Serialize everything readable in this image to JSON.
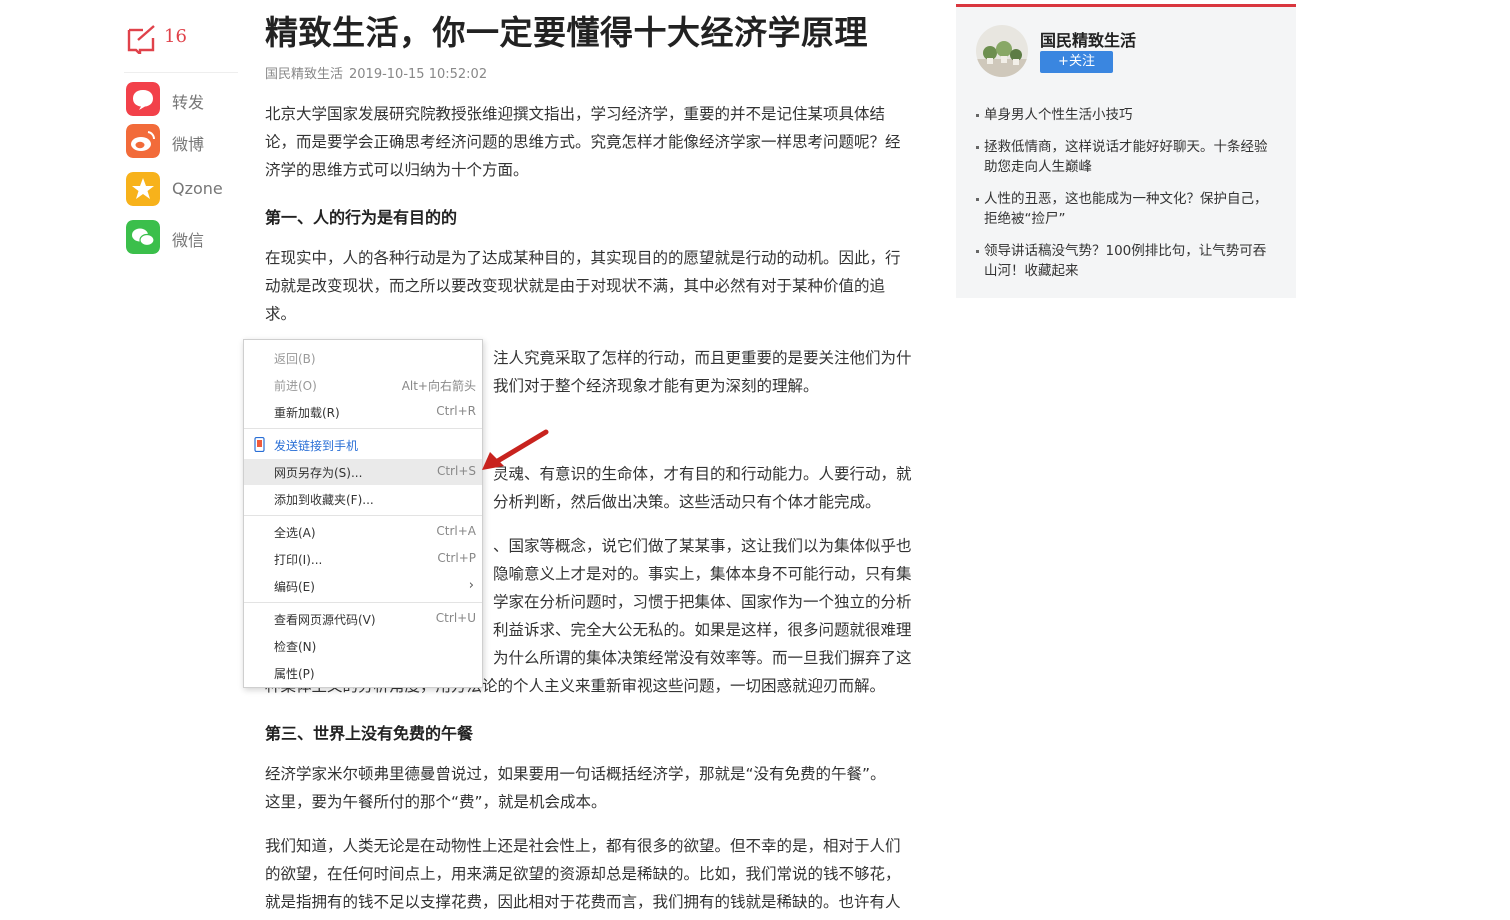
{
  "share": {
    "comment_count": "16",
    "items": [
      {
        "label": "转发",
        "icon": "repost-icon",
        "color": "#f2414a"
      },
      {
        "label": "微博",
        "icon": "weibo-icon",
        "color": "#f26b3a"
      },
      {
        "label": "Qzone",
        "icon": "qzone-icon",
        "color": "#f7b21b"
      },
      {
        "label": "微信",
        "icon": "wechat-icon",
        "color": "#3bbf4b"
      }
    ]
  },
  "article": {
    "title": "精致生活，你一定要懂得十大经济学原理",
    "author": "国民精致生活",
    "datetime": "2019-10-15 10:52:02",
    "p1_lines": [
      "北京大学国家发展研究院教授张维迎撰文指出，学习经济学，重要的并不是记住某项具体结",
      "论，而是要学会正确思考经济问题的思维方式。究竟怎样才能像经济学家一样思考问题呢？经",
      "济学的思维方式可以归纳为十个方面。"
    ],
    "h1": "第一、人的行为是有目的的",
    "p2_lines": [
      "在现实中，人的各种行动是为了达成某种目的，其实现目的的愿望就是行动的动机。因此，行",
      "动就是改变现状，而之所以要改变现状就是由于对现状不满，其中必然有对于某种价值的追",
      "求。"
    ],
    "p3_lines": [
      "注人究竟采取了怎样的行动，而且更重要的是要关注他们为什",
      "我们对于整个经济现象才能有更为深刻的理解。"
    ],
    "p4_lines": [
      "灵魂、有意识的生命体，才有目的和行动能力。人要行动，就",
      "分析判断，然后做出决策。这些活动只有个体才能完成。"
    ],
    "p5_lines": [
      "、国家等概念，说它们做了某某事，这让我们以为集体似乎也",
      "隐喻意义上才是对的。事实上，集体本身不可能行动，只有集",
      "学家在分析问题时，习惯于把集体、国家作为一个独立的分析",
      "利益诉求、完全大公无私的。如果是这样，很多问题就很难理",
      "为什么所谓的集体决策经常没有效率等。而一旦我们摒弃了这",
      "种集体主义的分析角度，用方法论的个人主义来重新审视这些问题，一切困惑就迎刃而解。"
    ],
    "h3": "第三、世界上没有免费的午餐",
    "p6_lines": [
      "经济学家米尔顿弗里德曼曾说过，如果要用一句话概括经济学，那就是“没有免费的午餐”。",
      "这里，要为午餐所付的那个“费”，就是机会成本。"
    ],
    "p7_lines": [
      "我们知道，人类无论是在动物性上还是社会性上，都有很多的欲望。但不幸的是，相对于人们",
      "的欲望，在任何时间点上，用来满足欲望的资源却总是稀缺的。比如，我们常说的钱不够花，",
      "就是指拥有的钱不足以支撑花费，因此相对于花费而言，我们拥有的钱就是稀缺的。也许有人"
    ]
  },
  "context_menu": {
    "back": {
      "label": "返回(B)",
      "shortcut": ""
    },
    "forward": {
      "label": "前进(O)",
      "shortcut": "Alt+向右箭头"
    },
    "reload": {
      "label": "重新加载(R)",
      "shortcut": "Ctrl+R"
    },
    "send": {
      "label": "发送链接到手机"
    },
    "save": {
      "label": "网页另存为(S)...",
      "shortcut": "Ctrl+S"
    },
    "bookmark": {
      "label": "添加到收藏夹(F)..."
    },
    "selectall": {
      "label": "全选(A)",
      "shortcut": "Ctrl+A"
    },
    "print": {
      "label": "打印(I)...",
      "shortcut": "Ctrl+P"
    },
    "encoding": {
      "label": "编码(E)"
    },
    "viewsource": {
      "label": "查看网页源代码(V)",
      "shortcut": "Ctrl+U"
    },
    "inspect": {
      "label": "检查(N)"
    },
    "properties": {
      "label": "属性(P)"
    }
  },
  "sidebar": {
    "author": "国民精致生活",
    "follow_label": "+关注",
    "related": [
      "单身男人个性生活小技巧",
      "拯救低情商，这样说话才能好好聊天。十条经验助您走向人生巅峰",
      "人性的丑恶，这也能成为一种文化？保护自己，拒绝被“捡尸”",
      "领导讲话稿没气势？100例排比句，让气势可吞山河！收藏起来"
    ]
  },
  "colors": {
    "accent_red": "#d9363e",
    "follow_blue": "#3a86e0",
    "highlight": "#eaeaea"
  }
}
